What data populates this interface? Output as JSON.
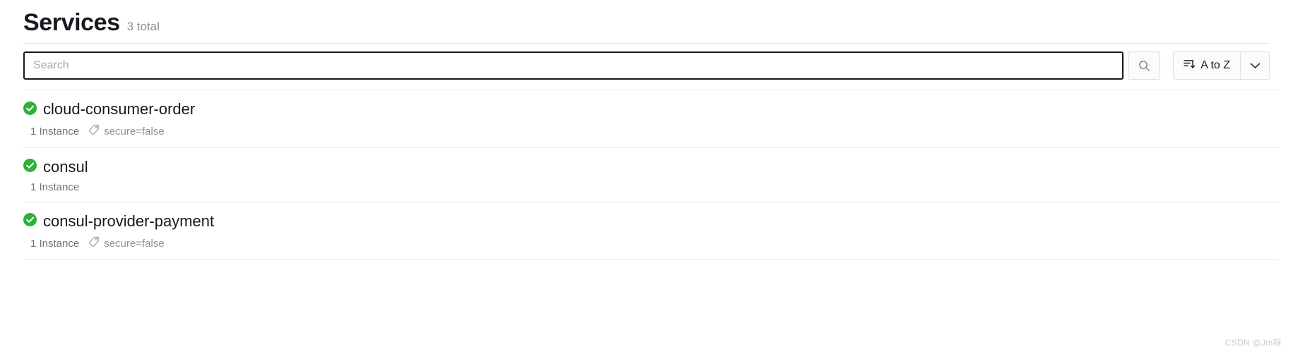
{
  "header": {
    "title": "Services",
    "count_label": "3 total"
  },
  "search": {
    "placeholder": "Search",
    "value": "",
    "search_icon": "search-icon"
  },
  "sort": {
    "label": "A to Z",
    "sort_icon": "sort-descending-icon",
    "caret_icon": "chevron-down-icon"
  },
  "services": [
    {
      "name": "cloud-consumer-order",
      "health_icon": "check-circle-icon",
      "health_status": "passing",
      "instances": "1 Instance",
      "tag_icon": "tag-icon",
      "tag": "secure=false"
    },
    {
      "name": "consul",
      "health_icon": "check-circle-icon",
      "health_status": "passing",
      "instances": "1 Instance",
      "tag_icon": "tag-icon",
      "tag": ""
    },
    {
      "name": "consul-provider-payment",
      "health_icon": "check-circle-icon",
      "health_status": "passing",
      "instances": "1 Instance",
      "tag_icon": "tag-icon",
      "tag": "secure=false"
    }
  ],
  "watermark": "CSDN @Jm呀",
  "colors": {
    "health_passing": "#2eb039",
    "text_primary": "#17191e",
    "text_muted": "#6f7682",
    "border": "#e6e8ed",
    "focus_border": "#17191e"
  }
}
